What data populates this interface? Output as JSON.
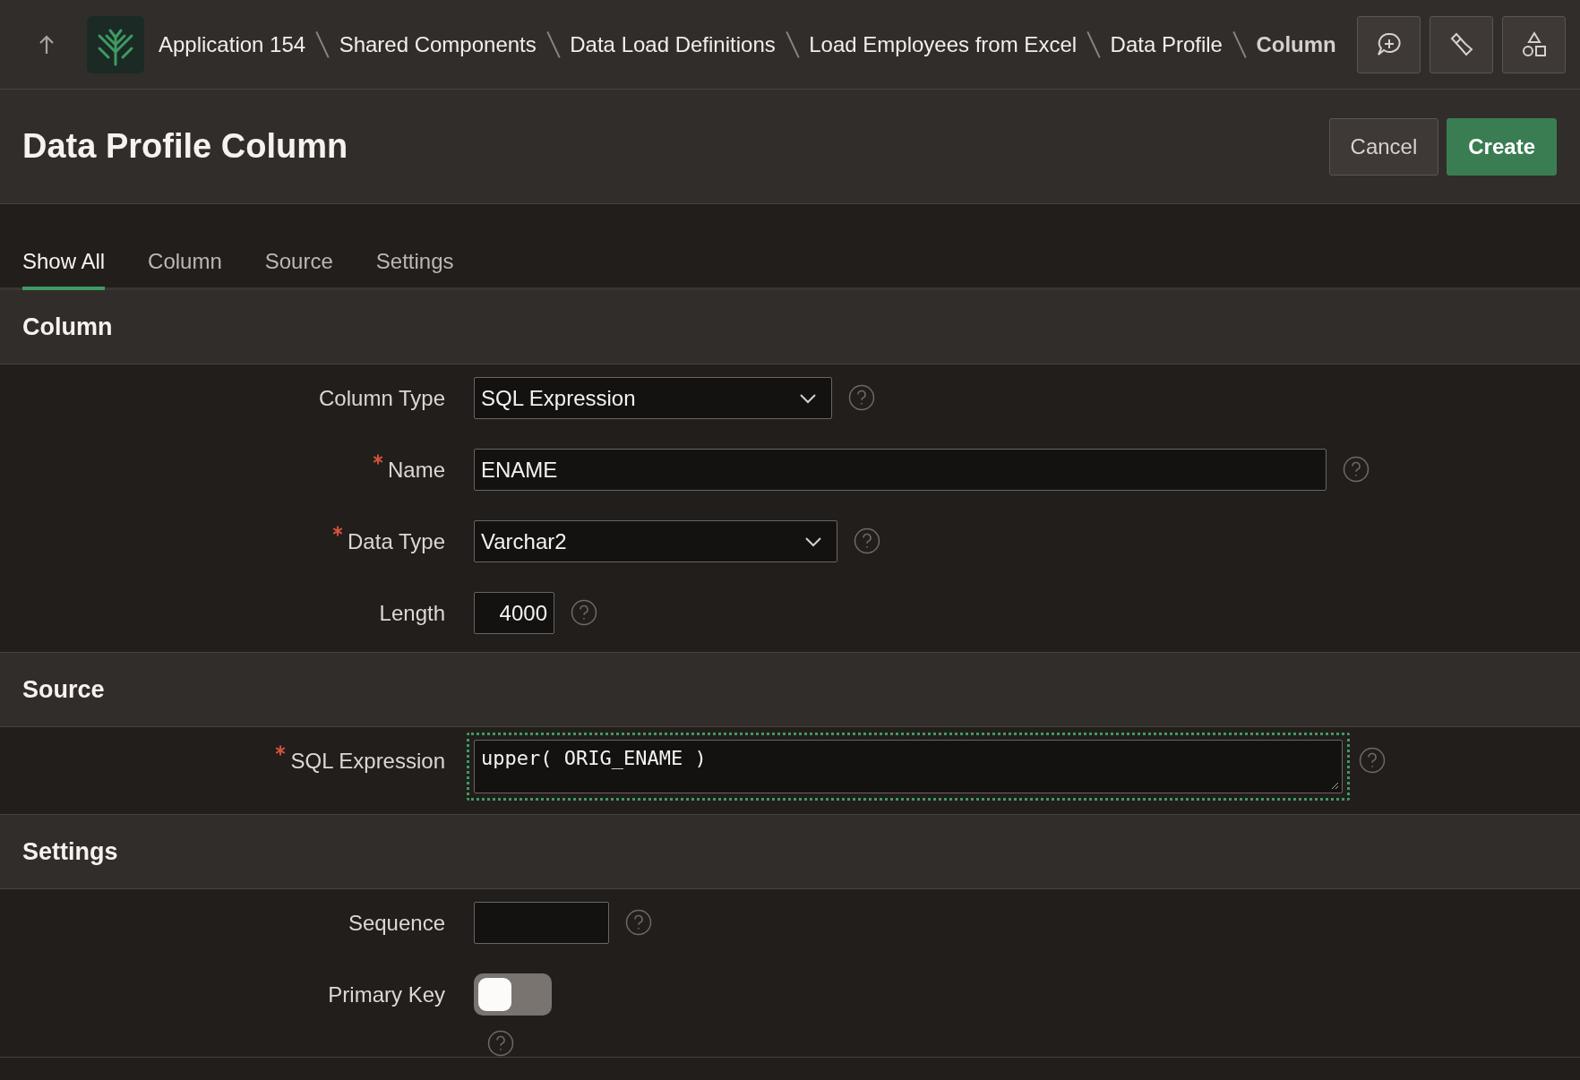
{
  "breadcrumbs": [
    {
      "label": "Application 154",
      "current": false
    },
    {
      "label": "Shared Components",
      "current": false
    },
    {
      "label": "Data Load Definitions",
      "current": false
    },
    {
      "label": "Load Employees from Excel",
      "current": false
    },
    {
      "label": "Data Profile",
      "current": false
    },
    {
      "label": "Column",
      "current": true
    }
  ],
  "page_title": "Data Profile Column",
  "buttons": [
    {
      "label": "Cancel",
      "kind": "secondary"
    },
    {
      "label": "Create",
      "kind": "primary"
    }
  ],
  "tabs": [
    {
      "label": "Show All",
      "selected": true
    },
    {
      "label": "Column",
      "selected": false
    },
    {
      "label": "Source",
      "selected": false
    },
    {
      "label": "Settings",
      "selected": false
    }
  ],
  "sections": [
    {
      "title": "Column",
      "fields": [
        {
          "label": "Column Type",
          "kind": "select",
          "value": "SQL Expression",
          "required": false
        },
        {
          "label": "Name",
          "kind": "text",
          "value": "ENAME",
          "required": true
        },
        {
          "label": "Data Type",
          "kind": "select",
          "value": "Varchar2",
          "required": true
        },
        {
          "label": "Length",
          "kind": "number",
          "value": "4000",
          "required": false
        }
      ]
    },
    {
      "title": "Source",
      "fields": [
        {
          "label": "SQL Expression",
          "kind": "textarea",
          "value": "upper( ORIG_ENAME )",
          "required": true,
          "focused": true
        }
      ]
    },
    {
      "title": "Settings",
      "fields": [
        {
          "label": "Sequence",
          "kind": "text",
          "required": false
        },
        {
          "label": "Primary Key",
          "kind": "switch",
          "on": false,
          "required": false
        }
      ]
    }
  ]
}
